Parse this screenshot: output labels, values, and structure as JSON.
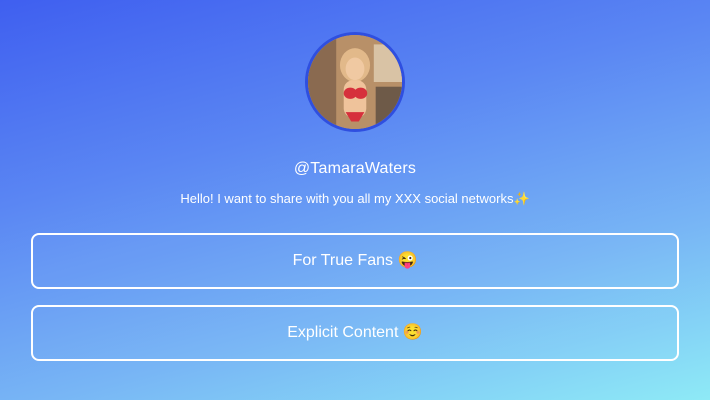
{
  "profile": {
    "username": "@TamaraWaters",
    "bio": "Hello! I want to share with you all my XXX social networks✨"
  },
  "links": [
    {
      "label": "For True Fans 😜"
    },
    {
      "label": "Explicit Content ☺️"
    }
  ],
  "colors": {
    "gradient_top": "#3f5ff0",
    "gradient_bottom": "#8eeaf6",
    "avatar_border": "#2f4fe0",
    "text": "#ffffff"
  }
}
